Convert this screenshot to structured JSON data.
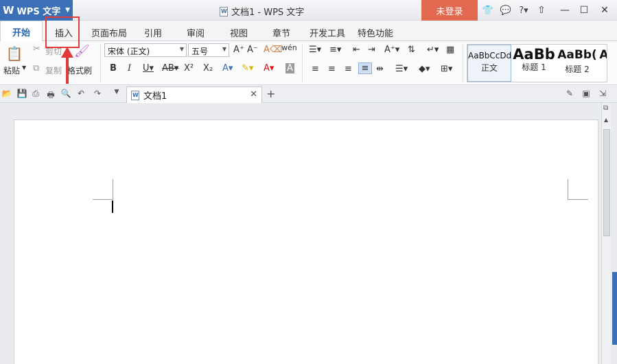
{
  "titlebar": {
    "app_name": "WPS 文字",
    "app_logo": "W",
    "document_title": "文档1 - WPS 文字",
    "login_label": "未登录",
    "accent": "#3b6fb6",
    "login_color": "#e2684f"
  },
  "tabs": [
    {
      "label": "开始"
    },
    {
      "label": "插入"
    },
    {
      "label": "页面布局"
    },
    {
      "label": "引用"
    },
    {
      "label": "审阅"
    },
    {
      "label": "视图"
    },
    {
      "label": "章节"
    },
    {
      "label": "开发工具"
    },
    {
      "label": "特色功能"
    }
  ],
  "ribbon": {
    "paste_label": "粘贴",
    "cut_label": "剪切",
    "copy_label": "复制",
    "format_painter_label": "格式刷",
    "font_name": "宋体 (正文)",
    "font_size": "五号",
    "styles": [
      {
        "preview": "AaBbCcDd",
        "name": "正文"
      },
      {
        "preview": "AaBb",
        "name": "标题 1"
      },
      {
        "preview": "AaBb(",
        "name": "标题 2"
      },
      {
        "preview": "A",
        "name": ""
      }
    ]
  },
  "doc_tabs": [
    {
      "label": "文档1"
    }
  ]
}
